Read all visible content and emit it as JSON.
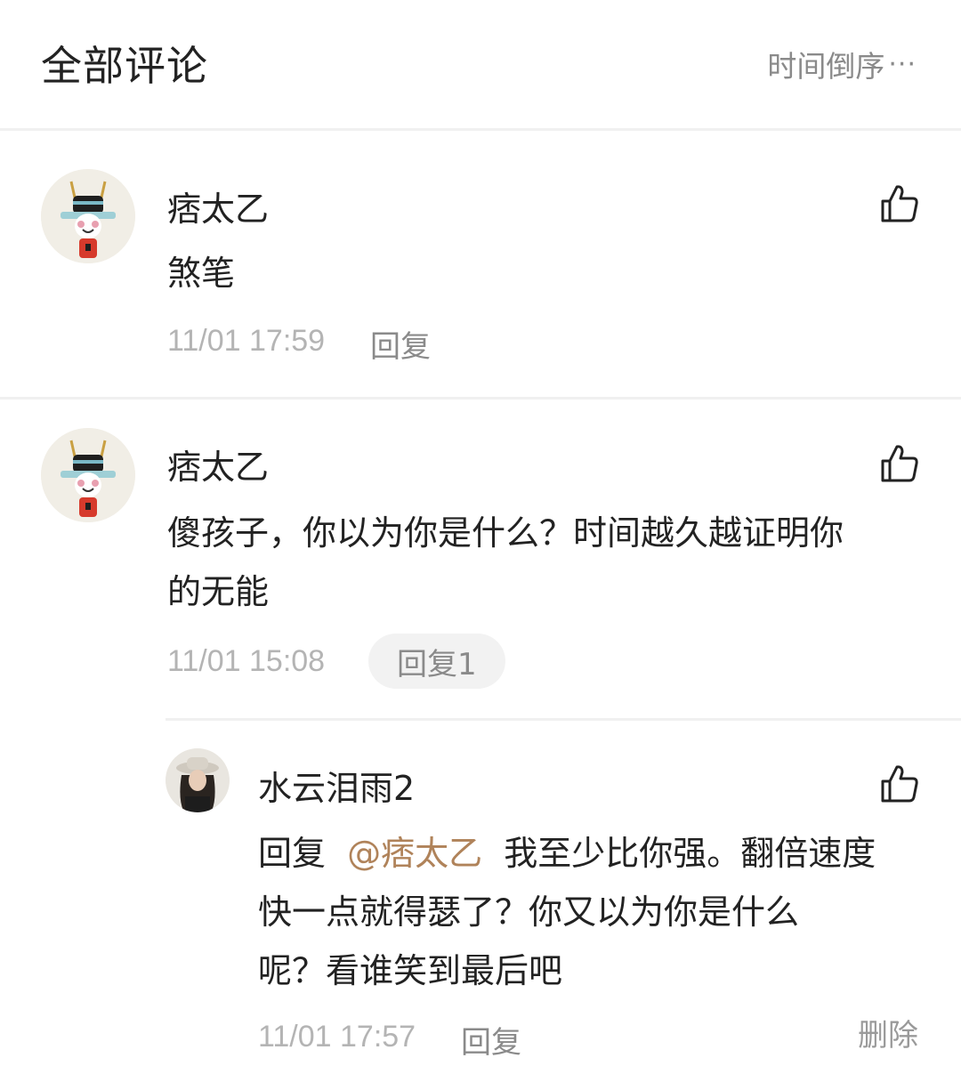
{
  "header": {
    "title": "全部评论",
    "sort_label": "时间倒序",
    "more": "···"
  },
  "comments": [
    {
      "username": "痞太乙",
      "text": "煞笔",
      "time": "11/01 17:59",
      "reply_label": "回复"
    },
    {
      "username": "痞太乙",
      "text_line1": "傻孩子，你以为你是什么？时间越久越证明你",
      "text_line2": "的无能",
      "time": "11/01 15:08",
      "reply_label": "回复1",
      "replies": [
        {
          "username": "水云泪雨2",
          "prefix": "回复",
          "mention": "@痞太乙",
          "text_line1": "我至少比你强。翻倍速度",
          "text_line2": "快一点就得瑟了？你又以为你是什么",
          "text_line3": "呢？看谁笑到最后吧",
          "time": "11/01 17:57",
          "reply_label": "回复",
          "delete_label": "删除"
        }
      ]
    }
  ],
  "colors": {
    "mention": "#b0835a",
    "muted": "#8a8a8a",
    "time": "#b4b4b4"
  },
  "icons": [
    "thumbs-up-icon",
    "avatar-opera-mask",
    "avatar-girl-hat"
  ]
}
